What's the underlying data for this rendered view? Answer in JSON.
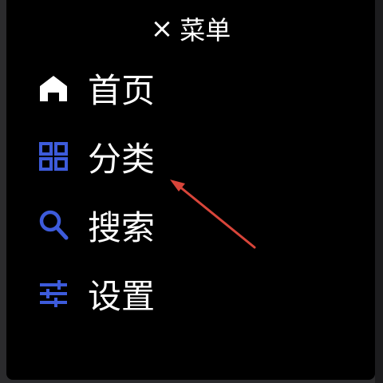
{
  "header": {
    "close_symbol": "×",
    "title": "菜单"
  },
  "menu": {
    "items": [
      {
        "label": "首页",
        "icon": "home-icon",
        "color": "#ffffff"
      },
      {
        "label": "分类",
        "icon": "grid-icon",
        "color": "#3d5bdb"
      },
      {
        "label": "搜索",
        "icon": "search-icon",
        "color": "#3d5bdb"
      },
      {
        "label": "设置",
        "icon": "sliders-icon",
        "color": "#3d5bdb"
      }
    ]
  },
  "colors": {
    "background": "#000000",
    "text": "#ffffff",
    "accent": "#3d5bdb",
    "annotation_arrow": "#d8453a"
  },
  "annotation": {
    "type": "arrow",
    "points_to": "分类"
  }
}
